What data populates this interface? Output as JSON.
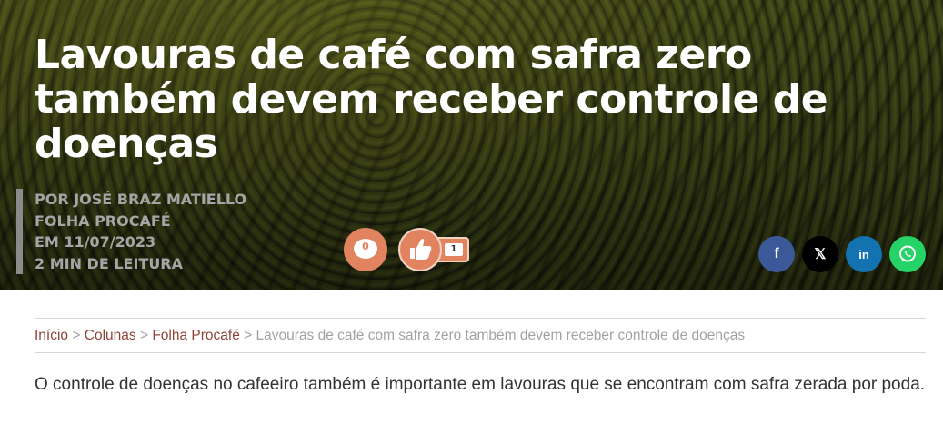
{
  "article": {
    "title": "Lavouras de café com safra zero também devem receber controle de doenças",
    "meta": {
      "author": "POR JOSÉ BRAZ MATIELLO",
      "column": "FOLHA PROCAFÉ",
      "date": "EM 11/07/2023",
      "reading_time": "2 MIN DE LEITURA"
    },
    "comments_count": "0",
    "likes_count": "1",
    "lead": "O controle de doenças no cafeeiro também é importante em lavouras que se encontram com safra zerada por poda."
  },
  "share": {
    "facebook_label": "f",
    "x_label": "𝕏",
    "linkedin_label": "in",
    "icons": [
      "facebook-icon",
      "x-icon",
      "linkedin-icon",
      "whatsapp-icon"
    ]
  },
  "breadcrumb": {
    "items": [
      "Início",
      "Colunas",
      "Folha Procafé"
    ],
    "separator": ">",
    "current": "Lavouras de café com safra zero também devem receber controle de doenças"
  },
  "colors": {
    "accent": "#e2835f",
    "link": "#8f4438",
    "facebook": "#3b5998",
    "linkedin": "#1273b0",
    "whatsapp": "#25d366"
  }
}
